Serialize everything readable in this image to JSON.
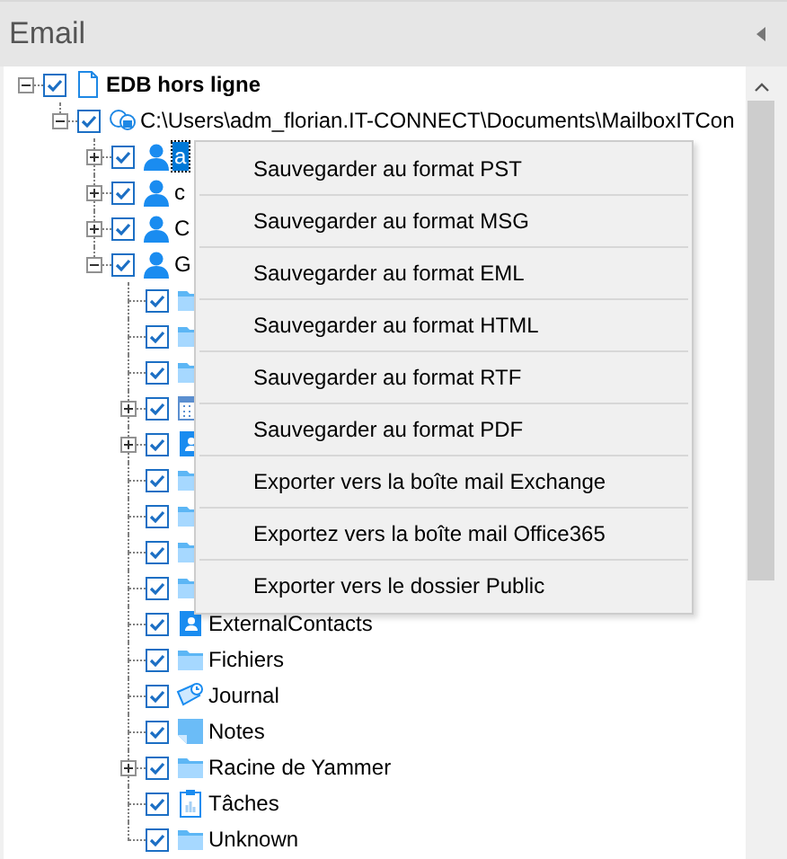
{
  "panel": {
    "title": "Email"
  },
  "tree": [
    {
      "label": "EDB hors ligne",
      "kind": "document",
      "bold": true,
      "checked": true,
      "expanded": true,
      "children": [
        {
          "label": "C:\\Users\\adm_florian.IT-CONNECT\\Documents\\MailboxITCon",
          "kind": "mailbox",
          "checked": true,
          "expanded": true,
          "children": [
            {
              "label": "a",
              "kind": "user",
              "checked": true,
              "expanded": false,
              "selected": true
            },
            {
              "label": "c",
              "kind": "user",
              "checked": true,
              "expanded": false,
              "selected": false
            },
            {
              "label": "C",
              "kind": "user",
              "checked": true,
              "expanded": false,
              "selected": false
            },
            {
              "label": "G",
              "kind": "user",
              "checked": true,
              "expanded": true,
              "selected": false,
              "children": [
                {
                  "kind": "folder",
                  "checked": true
                },
                {
                  "kind": "folder",
                  "checked": true
                },
                {
                  "kind": "folder",
                  "checked": true
                },
                {
                  "kind": "calendar",
                  "checked": true,
                  "expanded": false
                },
                {
                  "kind": "contacts",
                  "checked": true,
                  "expanded": false
                },
                {
                  "kind": "folder",
                  "checked": true
                },
                {
                  "kind": "folder",
                  "checked": true
                },
                {
                  "kind": "folder",
                  "checked": true
                },
                {
                  "kind": "folder",
                  "checked": true
                },
                {
                  "label": "ExternalContacts",
                  "kind": "contacts",
                  "checked": true
                },
                {
                  "label": "Fichiers",
                  "kind": "folder",
                  "checked": true
                },
                {
                  "label": "Journal",
                  "kind": "journal",
                  "checked": true
                },
                {
                  "label": "Notes",
                  "kind": "notes",
                  "checked": true
                },
                {
                  "label": "Racine de Yammer",
                  "kind": "folder",
                  "checked": true,
                  "expanded": false
                },
                {
                  "label": "Tâches",
                  "kind": "tasks",
                  "checked": true
                },
                {
                  "label": "Unknown",
                  "kind": "folder",
                  "checked": true
                }
              ]
            }
          ]
        }
      ]
    }
  ],
  "context_menu": [
    "Sauvegarder au format PST",
    "Sauvegarder au format MSG",
    "Sauvegarder au format EML",
    "Sauvegarder au format HTML",
    "Sauvegarder au format RTF",
    "Sauvegarder au format PDF",
    "Exporter vers la boîte mail Exchange",
    "Exportez vers la boîte mail Office365",
    "Exporter vers le dossier Public"
  ]
}
